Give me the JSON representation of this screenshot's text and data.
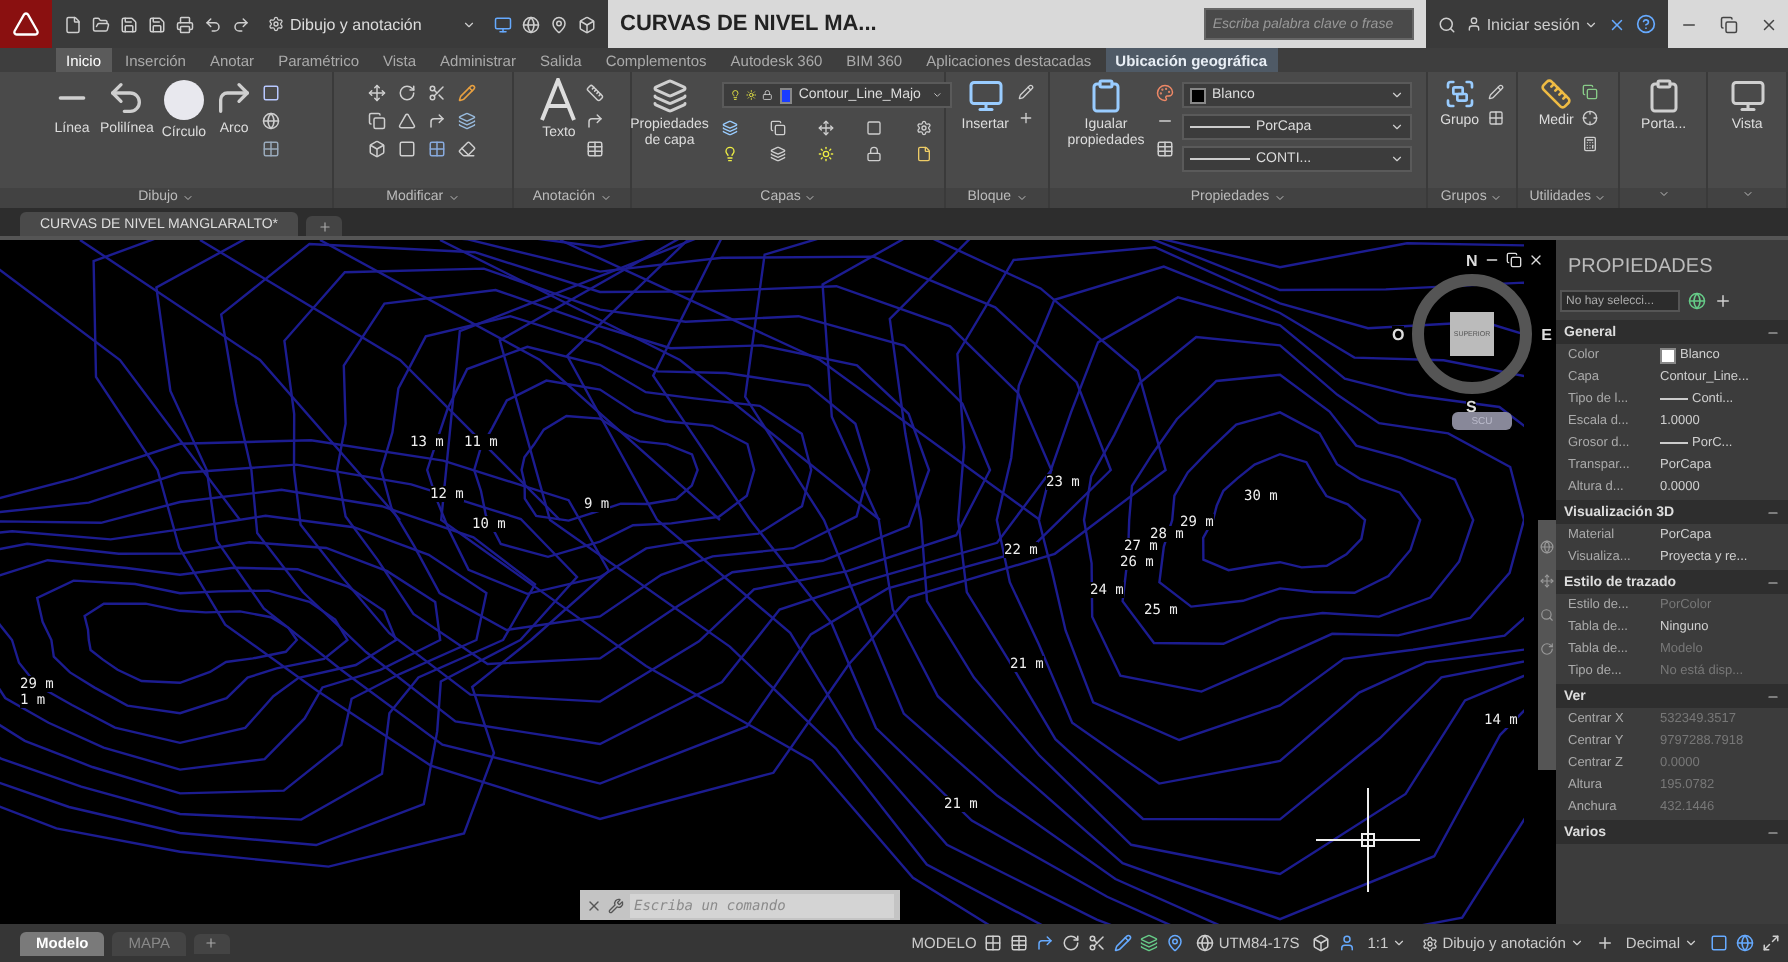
{
  "title_bar": {
    "workspace": "Dibujo y anotación",
    "title": "CURVAS DE NIVEL MA...",
    "search": {
      "placeholder": "Escriba palabra clave o frase"
    },
    "sign_in": "Iniciar sesión"
  },
  "ribbon_tabs": [
    {
      "label": "Inicio",
      "selected": true,
      "kind": "normal"
    },
    {
      "label": "Inserción",
      "selected": false,
      "kind": "normal"
    },
    {
      "label": "Anotar",
      "selected": false,
      "kind": "normal"
    },
    {
      "label": "Paramétrico",
      "selected": false,
      "kind": "normal"
    },
    {
      "label": "Vista",
      "selected": false,
      "kind": "normal"
    },
    {
      "label": "Administrar",
      "selected": false,
      "kind": "normal"
    },
    {
      "label": "Salida",
      "selected": false,
      "kind": "normal"
    },
    {
      "label": "Complementos",
      "selected": false,
      "kind": "normal"
    },
    {
      "label": "Autodesk 360",
      "selected": false,
      "kind": "normal"
    },
    {
      "label": "BIM 360",
      "selected": false,
      "kind": "normal"
    },
    {
      "label": "Aplicaciones destacadas",
      "selected": false,
      "kind": "normal"
    },
    {
      "label": "Ubicación geográfica",
      "selected": false,
      "kind": "contextual"
    }
  ],
  "ribbon_panels": [
    {
      "kind": "draw",
      "title": "Dibujo",
      "tools": [
        "Línea",
        "Polilínea",
        "Círculo",
        "Arco"
      ]
    },
    {
      "kind": "modify",
      "title": "Modificar"
    },
    {
      "kind": "annotate",
      "title": "Anotación",
      "tools": [
        "Texto"
      ]
    },
    {
      "kind": "layers",
      "title": "Capas",
      "tools": [
        "Propiedades de capa"
      ],
      "layer": "Contour_Line_Majo"
    },
    {
      "kind": "block",
      "title": "Bloque",
      "tools": [
        "Insertar"
      ]
    },
    {
      "kind": "properties",
      "title": "Propiedades",
      "tools": [
        "Igualar propiedades"
      ],
      "dropdowns": [
        "Blanco",
        "PorCapa",
        "CONTI..."
      ]
    },
    {
      "kind": "groups",
      "title": "Grupos",
      "tools": [
        "Grupo"
      ]
    },
    {
      "kind": "utilities",
      "title": "Utilidades",
      "tools": [
        "Medir"
      ]
    },
    {
      "kind": "single",
      "tools": [
        "Porta..."
      ]
    },
    {
      "kind": "single",
      "tools": [
        "Vista"
      ]
    }
  ],
  "document_tabs": [
    {
      "label": "CURVAS DE NIVEL MANGLARALTO*",
      "selected": true
    }
  ],
  "viewport": {
    "elevation_labels": [
      "13 m",
      "11 m",
      "12 m",
      "10 m",
      "9 m",
      "23 m",
      "30 m",
      "29 m",
      "28 m",
      "27 m",
      "26 m",
      "22 m",
      "24 m",
      "25 m",
      "21 m",
      "29 m",
      "1 m",
      "14 m",
      "21 m"
    ],
    "compass": {
      "north": "N",
      "south": "S",
      "east": "E",
      "west": "O",
      "face": "SUPERIOR",
      "ucs": "SCU"
    }
  },
  "command_line": {
    "placeholder": "Escriba un comando"
  },
  "properties": {
    "title": "PROPIEDADES",
    "selection": "No hay selecci...",
    "sections": [
      {
        "title": "General",
        "expanded": true,
        "rows": [
          {
            "kind": "color",
            "label": "Color",
            "value": "Blanco",
            "disabled": false
          },
          {
            "kind": "text",
            "label": "Capa",
            "value": "Contour_Line...",
            "disabled": false
          },
          {
            "kind": "line",
            "label": "Tipo de l...",
            "value": "Conti...",
            "disabled": false
          },
          {
            "kind": "text",
            "label": "Escala d...",
            "value": "1.0000",
            "disabled": false
          },
          {
            "kind": "line",
            "label": "Grosor d...",
            "value": "PorC...",
            "disabled": false
          },
          {
            "kind": "text",
            "label": "Transpar...",
            "value": "PorCapa",
            "disabled": false
          },
          {
            "kind": "text",
            "label": "Altura d...",
            "value": "0.0000",
            "disabled": false
          }
        ]
      },
      {
        "title": "Visualización 3D",
        "expanded": true,
        "rows": [
          {
            "kind": "text",
            "label": "Material",
            "value": "PorCapa",
            "disabled": false
          },
          {
            "kind": "text",
            "label": "Visualiza...",
            "value": "Proyecta y re...",
            "disabled": false
          }
        ]
      },
      {
        "title": "Estilo de trazado",
        "expanded": true,
        "rows": [
          {
            "kind": "text",
            "label": "Estilo de...",
            "value": "PorColor",
            "disabled": true
          },
          {
            "kind": "text",
            "label": "Tabla de...",
            "value": "Ninguno",
            "disabled": false
          },
          {
            "kind": "text",
            "label": "Tabla de...",
            "value": "Modelo",
            "disabled": true
          },
          {
            "kind": "text",
            "label": "Tipo de...",
            "value": "No está disp...",
            "disabled": true
          }
        ]
      },
      {
        "title": "Ver",
        "expanded": true,
        "rows": [
          {
            "kind": "text",
            "label": "Centrar X",
            "value": "532349.3517",
            "disabled": true
          },
          {
            "kind": "text",
            "label": "Centrar Y",
            "value": "9797288.7918",
            "disabled": true
          },
          {
            "kind": "text",
            "label": "Centrar Z",
            "value": "0.0000",
            "disabled": true
          },
          {
            "kind": "text",
            "label": "Altura",
            "value": "195.0782",
            "disabled": true
          },
          {
            "kind": "text",
            "label": "Anchura",
            "value": "432.1446",
            "disabled": true
          }
        ]
      },
      {
        "title": "Varios",
        "expanded": true
      }
    ]
  },
  "layout_tabs": [
    {
      "label": "Modelo",
      "selected": true
    },
    {
      "label": "MAPA",
      "selected": false
    }
  ],
  "status_bar": {
    "space": "MODELO",
    "coordinate_system": "UTM84-17S",
    "scale": "1:1",
    "workspace": "Dibujo y anotación",
    "units": "Decimal"
  }
}
